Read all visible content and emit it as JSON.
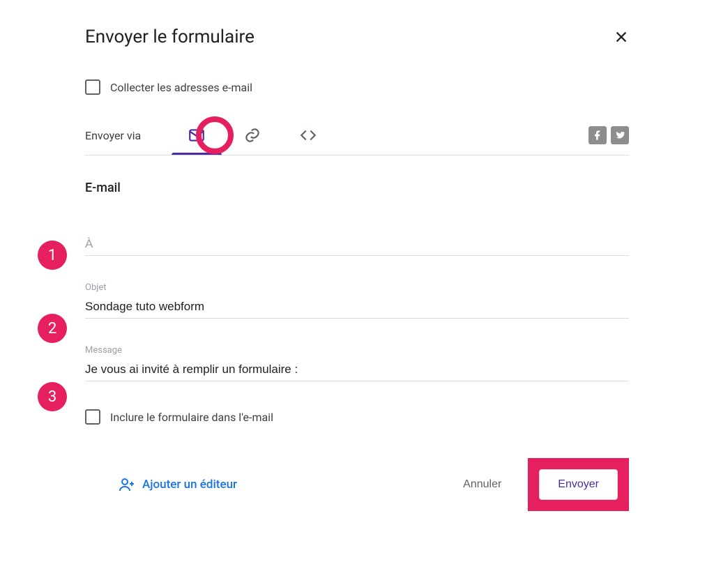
{
  "dialog": {
    "title": "Envoyer le formulaire",
    "collect_label": "Collecter les adresses e-mail",
    "via_label": "Envoyer via",
    "section_title": "E-mail",
    "include_label": "Inclure le formulaire dans l'e-mail"
  },
  "fields": {
    "to_placeholder": "À",
    "to_value": "",
    "subject_label": "Objet",
    "subject_value": "Sondage tuto webform",
    "message_label": "Message",
    "message_value": "Je vous ai invité à remplir un formulaire :"
  },
  "footer": {
    "add_editor": "Ajouter un éditeur",
    "cancel": "Annuler",
    "send": "Envoyer"
  },
  "badges": {
    "n1": "1",
    "n2": "2",
    "n3": "3"
  },
  "icons": {
    "close": "close-icon",
    "mail": "mail-icon",
    "link": "link-icon",
    "embed": "embed-icon",
    "facebook": "facebook-icon",
    "twitter": "twitter-icon",
    "person_add": "person-add-icon"
  },
  "colors": {
    "accent": "#4b2b9e",
    "highlight": "#e6205f",
    "link_blue": "#1a73e8"
  }
}
